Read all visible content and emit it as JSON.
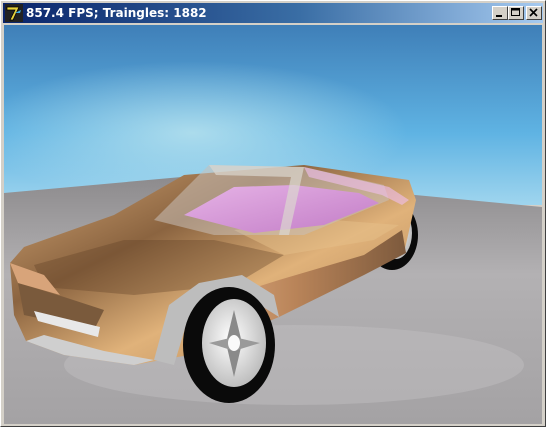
{
  "window": {
    "title": "857.4 FPS; Traingles: 1882",
    "app_icon_glyph": "7",
    "controls": [
      "minimize",
      "maximize",
      "close"
    ]
  },
  "scene": {
    "description_icons": [
      "car-model",
      "floor-plane",
      "sky-background"
    ]
  },
  "colors": {
    "titlebar_start": "#0a246a",
    "titlebar_end": "#a6caf0",
    "sky": "#4aa6d8",
    "floor": "#a9a7a8",
    "car_body": "#c9925a",
    "car_interior": "#d79ad8",
    "tire": "#0a0a0a",
    "rim": "#e6e6e6"
  }
}
